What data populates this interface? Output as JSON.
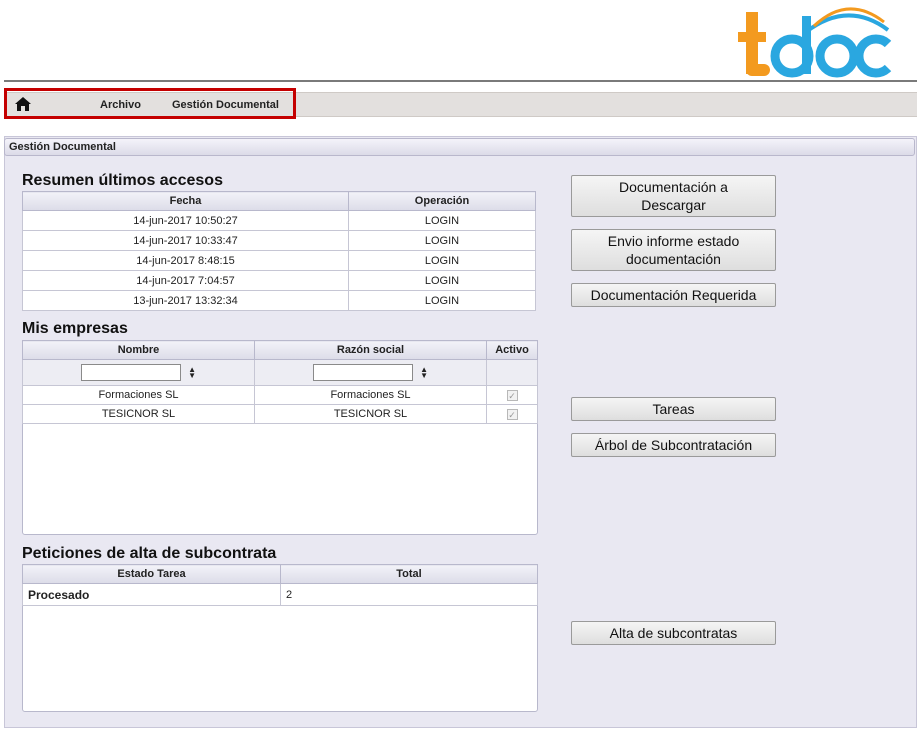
{
  "nav": {
    "archivo": "Archivo",
    "gestion": "Gestión Documental"
  },
  "panel": {
    "header": "Gestión Documental"
  },
  "resumen": {
    "title": "Resumen últimos accesos",
    "columns": [
      "Fecha",
      "Operación"
    ],
    "rows": [
      [
        "14-jun-2017 10:50:27",
        "LOGIN"
      ],
      [
        "14-jun-2017 10:33:47",
        "LOGIN"
      ],
      [
        "14-jun-2017 8:48:15",
        "LOGIN"
      ],
      [
        "14-jun-2017 7:04:57",
        "LOGIN"
      ],
      [
        "13-jun-2017 13:32:34",
        "LOGIN"
      ]
    ]
  },
  "empresas": {
    "title": "Mis empresas",
    "columns": [
      "Nombre",
      "Razón social",
      "Activo"
    ],
    "rows": [
      [
        "Formaciones SL",
        "Formaciones SL"
      ],
      [
        "TESICNOR SL",
        "TESICNOR SL"
      ]
    ]
  },
  "peticiones": {
    "title": "Peticiones de alta de subcontrata",
    "columns": [
      "Estado Tarea",
      "Total"
    ],
    "rows": [
      [
        "Procesado",
        "2"
      ]
    ]
  },
  "buttons": {
    "doc_descargar_l1": "Documentación a",
    "doc_descargar_l2": "Descargar",
    "envio_l1": "Envio informe estado",
    "envio_l2": "documentación",
    "doc_requerida": "Documentación Requerida",
    "tareas": "Tareas",
    "arbol": "Árbol de Subcontratación",
    "alta": "Alta de subcontratas"
  },
  "colors": {
    "logo_orange": "#f39a1f",
    "logo_blue": "#2aa7e0",
    "highlight": "#c40000",
    "status_green": "#0a7a1a"
  }
}
